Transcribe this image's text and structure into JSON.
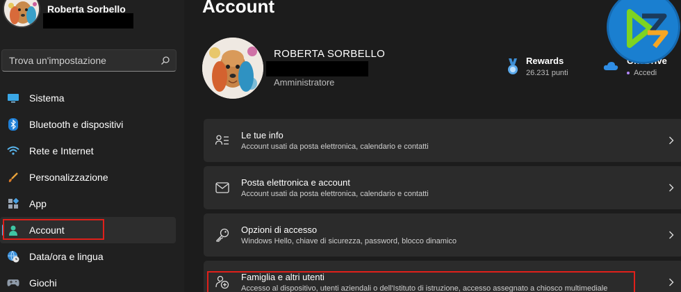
{
  "profile": {
    "name": "Roberta Sorbello"
  },
  "search": {
    "placeholder": "Trova un'impostazione"
  },
  "sidebar": {
    "items": [
      {
        "label": "Sistema",
        "icon": "monitor-icon"
      },
      {
        "label": "Bluetooth e dispositivi",
        "icon": "bluetooth-icon"
      },
      {
        "label": "Rete e Internet",
        "icon": "wifi-icon"
      },
      {
        "label": "Personalizzazione",
        "icon": "brush-icon"
      },
      {
        "label": "App",
        "icon": "apps-icon"
      },
      {
        "label": "Account",
        "icon": "person-icon",
        "active": true
      },
      {
        "label": "Data/ora e lingua",
        "icon": "globe-clock-icon"
      },
      {
        "label": "Giochi",
        "icon": "gamepad-icon"
      }
    ]
  },
  "main": {
    "title": "Account",
    "user": {
      "name": "ROBERTA SORBELLO",
      "role": "Amministratore"
    },
    "rewards": {
      "title": "Rewards",
      "points": "26.231 punti"
    },
    "onedrive": {
      "title": "OneDrive",
      "action": "Accedi"
    },
    "cards": [
      {
        "title": "Le tue info",
        "subtitle": "Account usati da posta elettronica, calendario e contatti",
        "icon": "user-info-icon"
      },
      {
        "title": "Posta elettronica e account",
        "subtitle": "Account usati da posta elettronica, calendario e contatti",
        "icon": "mail-icon"
      },
      {
        "title": "Opzioni di accesso",
        "subtitle": "Windows Hello, chiave di sicurezza, password, blocco dinamico",
        "icon": "key-icon"
      },
      {
        "title": "Famiglia e altri utenti",
        "subtitle": "Accesso al dispositivo, utenti aziendali o dell'Istituto di istruzione, accesso assegnato a chiosco multimediale",
        "icon": "family-add-icon"
      }
    ]
  },
  "colors": {
    "accent": "#4cc2ff",
    "highlight": "#e0201a",
    "background": "#1c1c1c",
    "card": "#2b2b2b"
  }
}
